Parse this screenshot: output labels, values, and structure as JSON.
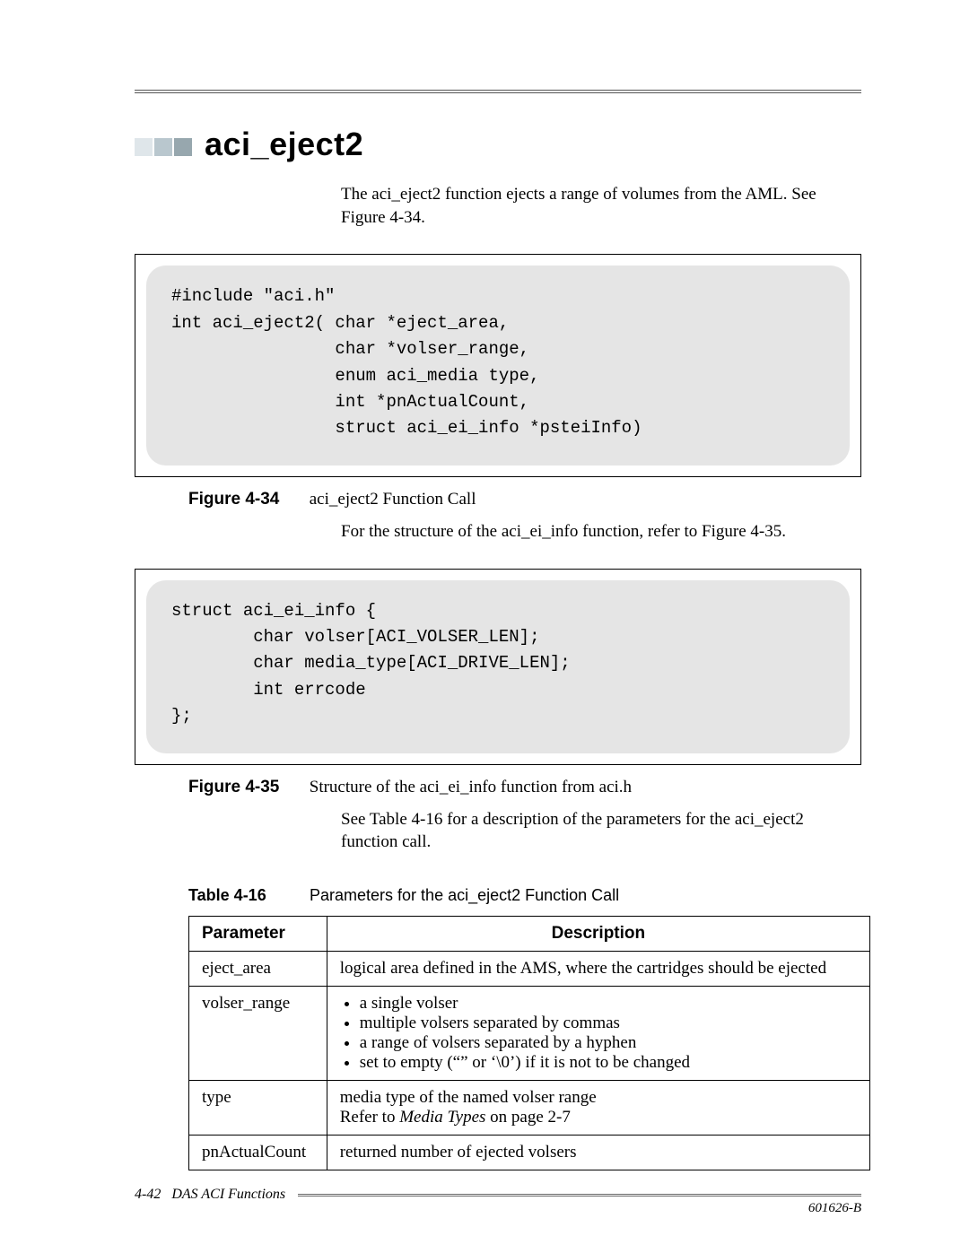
{
  "heading": "aci_eject2",
  "intro": "The aci_eject2 function ejects a range of volumes from the AML. See Figure 4-34.",
  "code1": "#include \"aci.h\"\nint aci_eject2( char *eject_area,\n                char *volser_range,\n                enum aci_media type,\n                int *pnActualCount,\n                struct aci_ei_info *psteiInfo)",
  "fig34": {
    "label": "Figure 4-34",
    "title": "aci_eject2 Function Call"
  },
  "after_fig34": "For the structure of the aci_ei_info function, refer to Figure 4-35.",
  "code2": "struct aci_ei_info {\n        char volser[ACI_VOLSER_LEN];\n        char media_type[ACI_DRIVE_LEN];\n        int errcode\n};",
  "fig35": {
    "label": "Figure 4-35",
    "title": "Structure of the aci_ei_info function from aci.h"
  },
  "after_fig35": "See Table 4-16 for a description of the parameters for the aci_eject2 function call.",
  "table": {
    "label": "Table 4-16",
    "title": "Parameters for the aci_eject2 Function Call",
    "headers": {
      "param": "Parameter",
      "desc": "Description"
    },
    "rows": [
      {
        "param": "eject_area",
        "desc_plain": "logical area defined in the AMS, where the cartridges should be ejected"
      },
      {
        "param": "volser_range",
        "bullets": [
          "a single volser",
          "multiple volsers separated by commas",
          "a range of volsers separated by a hyphen",
          "set to empty (“” or ‘\\0’) if it is not to be changed"
        ]
      },
      {
        "param": "type",
        "desc_line1": "media type of the named volser range",
        "desc_line2_pre": "Refer to ",
        "desc_line2_ital": "Media Types",
        "desc_line2_post": "  on page 2-7"
      },
      {
        "param": "pnActualCount",
        "desc_plain": "returned number of ejected volsers"
      }
    ]
  },
  "footer": {
    "page": "4-42",
    "section": "DAS ACI Functions",
    "docnum": "601626-B"
  }
}
